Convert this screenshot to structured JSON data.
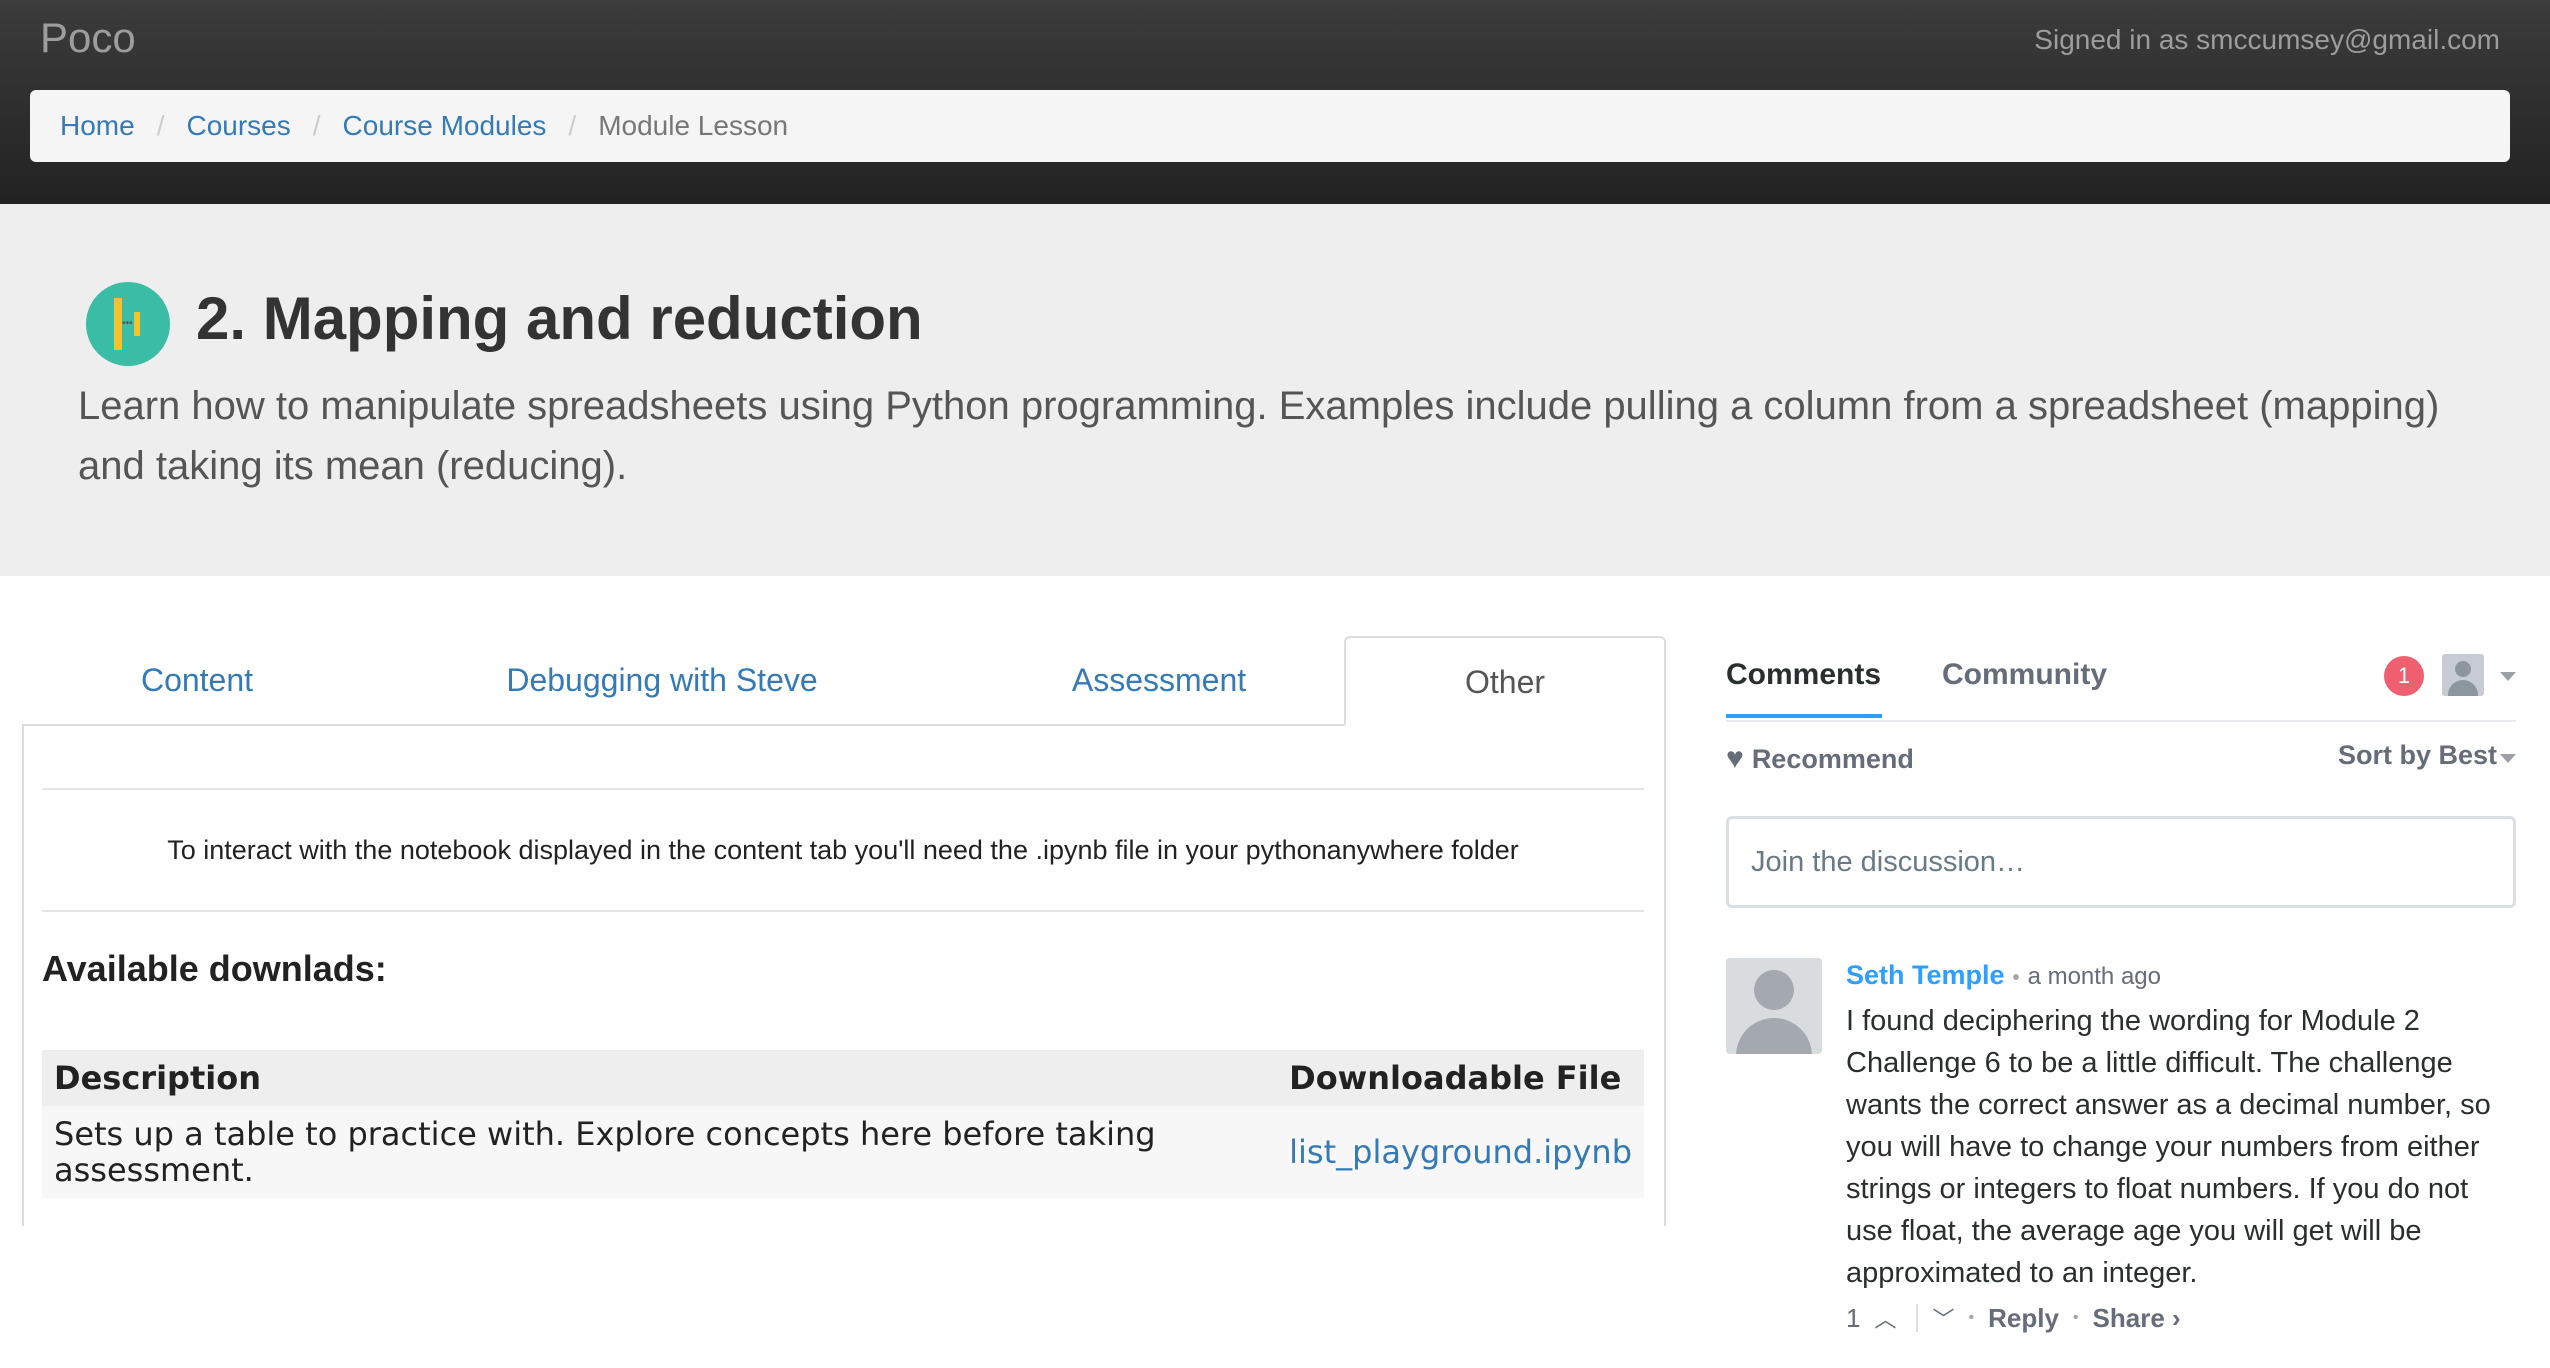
{
  "navbar": {
    "brand": "Poco",
    "signed_in": "Signed in as smccumsey@gmail.com"
  },
  "breadcrumb": {
    "items": [
      "Home",
      "Courses",
      "Course Modules"
    ],
    "active": "Module Lesson",
    "separator": "/"
  },
  "lesson": {
    "title": "2. Mapping and reduction",
    "description": "Learn how to manipulate spreadsheets using Python programming. Examples include pulling a column from a spreadsheet (mapping) and taking its mean (reducing)."
  },
  "tabs": {
    "items": [
      "Content",
      "Debugging with Steve",
      "Assessment",
      "Other"
    ],
    "active": "Other"
  },
  "other_tab": {
    "note": "To interact with the notebook displayed in the content tab you'll need the .ipynb file in your pythonanywhere folder",
    "downloads_heading": "Available downlads:",
    "table": {
      "headers": [
        "Description",
        "Downloadable File"
      ],
      "rows": [
        {
          "description": "Sets up a table to practice with. Explore concepts here before taking assessment.",
          "file": "list_playground.ipynb"
        }
      ]
    }
  },
  "disqus": {
    "tabs": [
      "Comments",
      "Community"
    ],
    "notification_count": "1",
    "recommend": "Recommend",
    "sort": "Sort by Best",
    "join_placeholder": "Join the discussion…",
    "comment": {
      "author": "Seth Temple",
      "separator": "•",
      "time": "a month ago",
      "text": "I found deciphering the wording for Module 2 Challenge 6 to be a little difficult. The challenge wants the correct answer as a decimal number, so you will have to change your numbers from either strings or integers to float numbers. If you do not use float, the average age you will get will be approximated to an integer.",
      "votes": "1",
      "reply": "Reply",
      "share": "Share ›"
    },
    "colors": {
      "accent": "#2e9fff",
      "badge": "#f05f70"
    }
  }
}
